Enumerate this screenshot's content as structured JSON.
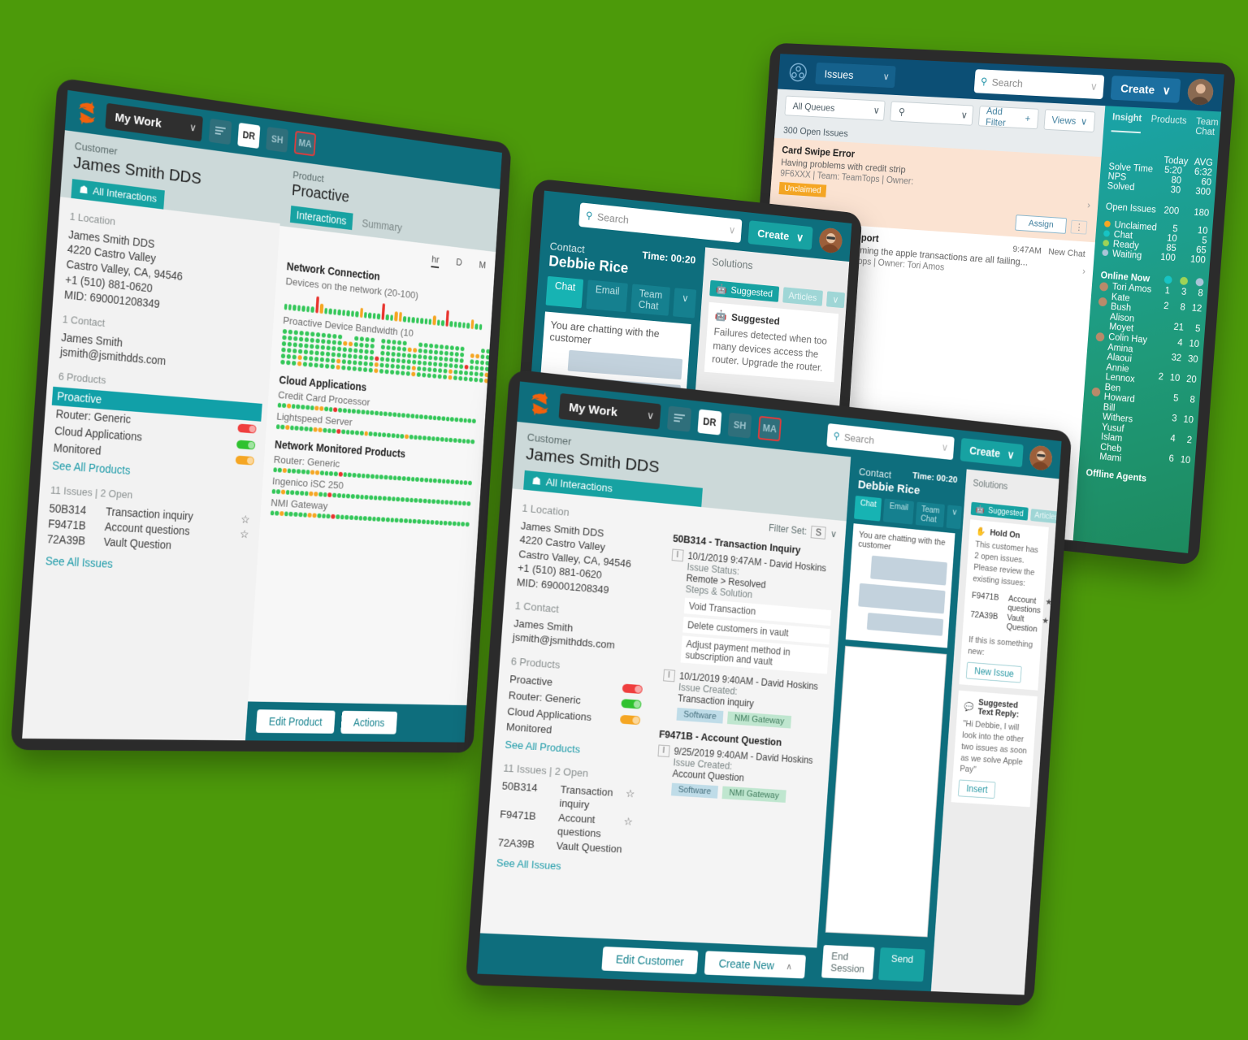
{
  "brand": {
    "accent": "#17a2a2",
    "dark_teal": "#0e6e7d",
    "blue": "#0c4f75",
    "bg": "#4c9a0a"
  },
  "support_app": {
    "appbar": {
      "work_selector": "My Work",
      "chevron": "∨",
      "chips": [
        {
          "label": "",
          "name": "queue-lines-icon",
          "state": "icon"
        },
        {
          "label": "DR",
          "state": "selected"
        },
        {
          "label": "SH",
          "state": "normal"
        },
        {
          "label": "MA",
          "state": "alert"
        }
      ],
      "search_placeholder": "Search",
      "create_label": "Create"
    },
    "customer": {
      "label": "Customer",
      "name": "James Smith DDS",
      "all_interactions": "All Interactions",
      "location_heading": "1 Location",
      "location_lines": [
        "James Smith DDS",
        "4220 Castro Valley",
        "Castro Valley, CA, 94546",
        "+1 (510) 881-0620",
        "MID: 690001208349"
      ],
      "contact_heading": "1 Contact",
      "contact_lines": [
        "James Smith",
        "jsmith@jsmithdds.com"
      ],
      "products_heading": "6 Products",
      "products": [
        {
          "name": "Proactive",
          "status": "red"
        },
        {
          "name": "Router: Generic",
          "status": "green"
        },
        {
          "name": "Cloud Applications",
          "status": "amber"
        },
        {
          "name": "Monitored",
          "status": ""
        }
      ],
      "see_all_products": "See All Products",
      "issues_heading": "11 Issues | 2 Open",
      "issues": [
        {
          "id": "50B314",
          "title": "Transaction inquiry",
          "starred": true
        },
        {
          "id": "F9471B",
          "title": "Account questions",
          "starred": true
        },
        {
          "id": "72A39B",
          "title": "Vault Question",
          "starred": false
        }
      ],
      "see_all_issues": "See All Issues"
    },
    "product_panel": {
      "label": "Product",
      "name": "Proactive",
      "tabs": [
        {
          "label": "Interactions",
          "active": true
        },
        {
          "label": "Summary",
          "active": false
        }
      ],
      "range_options": [
        {
          "label": "hr",
          "active": true
        },
        {
          "label": "D",
          "active": false
        },
        {
          "label": "M",
          "active": false
        }
      ],
      "sections": [
        {
          "heading": "Network Connection",
          "items": [
            {
              "label": "Devices on the network (20-100)",
              "viz": "spark"
            },
            {
              "label": "Proactive Device Bandwidth (10",
              "viz": "grid"
            }
          ]
        },
        {
          "heading": "Cloud Applications",
          "items": [
            {
              "label": "Credit Card Processor",
              "viz": "dots"
            },
            {
              "label": "Lightspeed Server",
              "viz": "dots"
            }
          ]
        },
        {
          "heading": "Network Monitored Products",
          "items": [
            {
              "label": "Router: Generic",
              "viz": "dots"
            },
            {
              "label": "Ingenico iSC 250",
              "viz": "dots"
            },
            {
              "label": "NMI Gateway",
              "viz": "dots"
            }
          ]
        }
      ],
      "buttons": [
        "Edit Product",
        "Actions"
      ]
    },
    "interaction_panel": {
      "filter_set_label": "Filter Set:",
      "filter_set_value": "S",
      "groups": [
        {
          "title": "50B314 - Transaction Inquiry",
          "entries": [
            {
              "stamp": "10/1/2019 9:47AM - David Hoskins",
              "status_label": "Issue Status:",
              "status_value": "Remote > Resolved",
              "steps_label": "Steps & Solution",
              "steps": [
                "Void Transaction",
                "Delete customers in vault",
                "Adjust payment method in subscription and vault"
              ],
              "tags": []
            },
            {
              "stamp": "10/1/2019 9:40AM - David Hoskins",
              "status_label": "Issue Created:",
              "status_value": "Transaction inquiry",
              "steps_label": "",
              "steps": [],
              "tags": [
                "Software",
                "NMI Gateway"
              ]
            }
          ]
        },
        {
          "title": "F9471B - Account Question",
          "entries": [
            {
              "stamp": "9/25/2019 9:40AM - David Hoskins",
              "status_label": "Issue Created:",
              "status_value": "Account Question",
              "steps_label": "",
              "steps": [],
              "tags": [
                "Software",
                "NMI Gateway"
              ]
            }
          ]
        }
      ],
      "buttons": [
        "Edit Customer",
        "Create New"
      ],
      "create_new_caret": "∧"
    },
    "contact_panel": {
      "label": "Contact",
      "name": "Debbie Rice",
      "timer_label": "Time: 00:20",
      "channels": [
        {
          "label": "Chat",
          "active": true
        },
        {
          "label": "Email",
          "active": false
        },
        {
          "label": "Team Chat",
          "active": false
        },
        {
          "label": "∨",
          "active": false
        }
      ],
      "transcript_note": "You are chatting with the customer",
      "end_session": "End Session",
      "send": "Send"
    },
    "solutions_panel": {
      "title": "Solutions",
      "tabs": [
        {
          "label": "Suggested",
          "active": true,
          "icon": "robot-icon"
        },
        {
          "label": "Articles",
          "active": false
        },
        {
          "label": "∨",
          "active": false
        }
      ],
      "cards_mid": [
        {
          "icon": "robot-icon",
          "heading": "Suggested",
          "body": "Failures detected when too many devices access the router. Upgrade the router."
        }
      ],
      "cards_front": [
        {
          "icon": "hand-icon",
          "heading": "Hold On",
          "body": "This customer has 2 open issues. Please review the existing issues:",
          "issues": [
            {
              "id": "F9471B",
              "title": "Account questions",
              "starred": true
            },
            {
              "id": "72A39B",
              "title": "Vault Question",
              "starred": true
            }
          ],
          "footer_note": "If this is something new:",
          "button": "New Issue"
        },
        {
          "icon": "reply-icon",
          "heading": "Suggested Text Reply:",
          "body": "\"Hi Debbie, I will look into the other two issues as soon as we solve Apple Pay\"",
          "issues": [],
          "footer_note": "",
          "button": "Insert"
        }
      ]
    }
  },
  "issues_app": {
    "appbar": {
      "module": "Issues",
      "chevron": "∨",
      "search_placeholder": "Search",
      "create_label": "Create"
    },
    "filters": {
      "queue_select": "All Queues",
      "query_placeholder": "",
      "add_filter": "Add Filter",
      "add_filter_icon": "+",
      "views": "Views",
      "count_label": "300 Open Issues"
    },
    "issues": [
      {
        "title": "Card Swipe Error",
        "message": "Having problems with credit strip",
        "meta": "9F6XXX | Team: TeamTops | Owner:",
        "badge": "Unclaimed",
        "assign": "Assign",
        "highlight": true,
        "time": "",
        "channel": ""
      },
      {
        "title": "Apple Pay Tech Support",
        "message": "Issue: Merchant is claiming the apple transactions are all failing...",
        "meta": "9F674F | Team: TeamTops | Owner: Tori Amos",
        "badge": "",
        "assign": "",
        "highlight": false,
        "time": "9:47AM",
        "channel": "New Chat"
      }
    ],
    "insight": {
      "tabs": [
        {
          "label": "Insight",
          "active": true
        },
        {
          "label": "Products",
          "active": false
        },
        {
          "label": "Team Chat",
          "active": false
        }
      ],
      "columns": [
        "Today",
        "AVG"
      ],
      "stats": [
        {
          "label": "Solve Time",
          "today": "5:20",
          "avg": "6:32"
        },
        {
          "label": "NPS",
          "today": "80",
          "avg": "60"
        },
        {
          "label": "Solved",
          "today": "30",
          "avg": "300"
        }
      ],
      "open_issues": {
        "label": "Open Issues",
        "today": "200",
        "avg": "180"
      },
      "queues": [
        {
          "label": "Unclaimed",
          "color": "#f5a623",
          "today": "5",
          "avg": "10"
        },
        {
          "label": "Chat",
          "color": "#17c4c4",
          "today": "10",
          "avg": "5"
        },
        {
          "label": "Ready",
          "color": "#9fd356",
          "today": "85",
          "avg": "65"
        },
        {
          "label": "Waiting",
          "color": "#a9c4d8",
          "today": "100",
          "avg": "100"
        }
      ],
      "online_heading": "Online Now",
      "online_cols": [
        "#17c4c4",
        "#9fd356",
        "#a9c4d8"
      ],
      "agents": [
        {
          "name": "Tori Amos",
          "c1": "1",
          "c2": "3",
          "c3": "8",
          "avatar": true
        },
        {
          "name": "Kate Bush",
          "c1": "2",
          "c2": "8",
          "c3": "12",
          "avatar": true
        },
        {
          "name": "Alison Moyet",
          "c1": "",
          "c2": "21",
          "c3": "5",
          "avatar": false
        },
        {
          "name": "Colin Hay",
          "c1": "",
          "c2": "4",
          "c3": "10",
          "avatar": true
        },
        {
          "name": "Amina Alaoui",
          "c1": "",
          "c2": "32",
          "c3": "30",
          "avatar": false
        },
        {
          "name": "Annie Lennox",
          "c1": "2",
          "c2": "10",
          "c3": "20",
          "avatar": false
        },
        {
          "name": "Ben Howard",
          "c1": "",
          "c2": "5",
          "c3": "8",
          "avatar": true
        },
        {
          "name": "Bill Withers",
          "c1": "",
          "c2": "3",
          "c3": "10",
          "avatar": false
        },
        {
          "name": "Yusuf Islam",
          "c1": "",
          "c2": "4",
          "c3": "2",
          "avatar": false
        },
        {
          "name": "Cheb Mami",
          "c1": "",
          "c2": "6",
          "c3": "10",
          "avatar": false
        }
      ],
      "offline_heading": "Offline Agents"
    }
  }
}
